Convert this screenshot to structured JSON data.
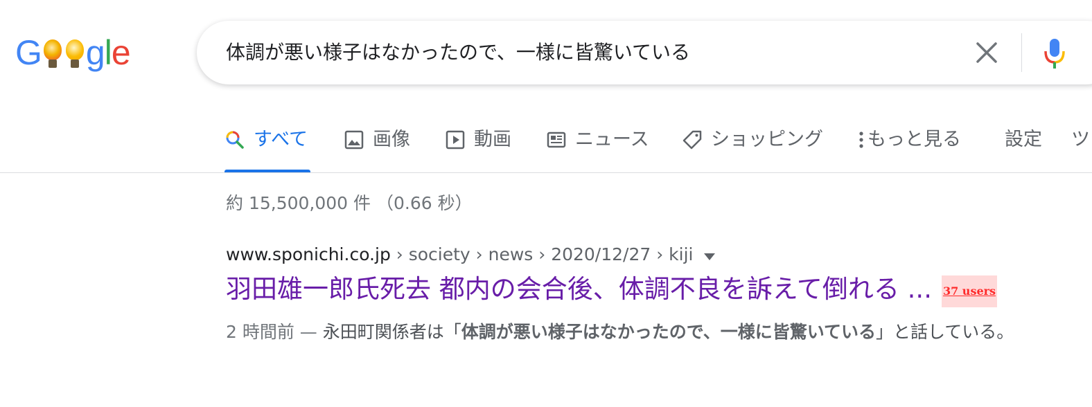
{
  "logo": {
    "text": "Google"
  },
  "search": {
    "query": "体調が悪い様子はなかったので、一様に皆驚いている"
  },
  "tabs": [
    {
      "label": "すべて",
      "icon": "search-icon",
      "active": true
    },
    {
      "label": "画像",
      "icon": "image-icon"
    },
    {
      "label": "動画",
      "icon": "video-icon"
    },
    {
      "label": "ニュース",
      "icon": "news-icon"
    },
    {
      "label": "ショッピング",
      "icon": "tag-icon"
    },
    {
      "label": "もっと見る",
      "icon": "more-vert-icon"
    },
    {
      "label": "設定"
    },
    {
      "label": "ツ"
    }
  ],
  "stats": "約 15,500,000 件 （0.66 秒）",
  "result": {
    "site": "www.sponichi.co.jp",
    "path": " › society › news › 2020/12/27 › kiji",
    "title": "羽田雄一郎氏死去 都内の会合後、体調不良を訴えて倒れる ...",
    "users_badge": "37 users",
    "date": "2 時間前",
    "dash": " — ",
    "snippet_pre": "永田町関係者は「",
    "snippet_bold": "体調が悪い様子はなかったので、一様に皆驚いている",
    "snippet_post": "」と話している。"
  },
  "colors": {
    "accent": "#1a73e8",
    "visited_link": "#681da8",
    "badge": "#ff2a2a"
  }
}
